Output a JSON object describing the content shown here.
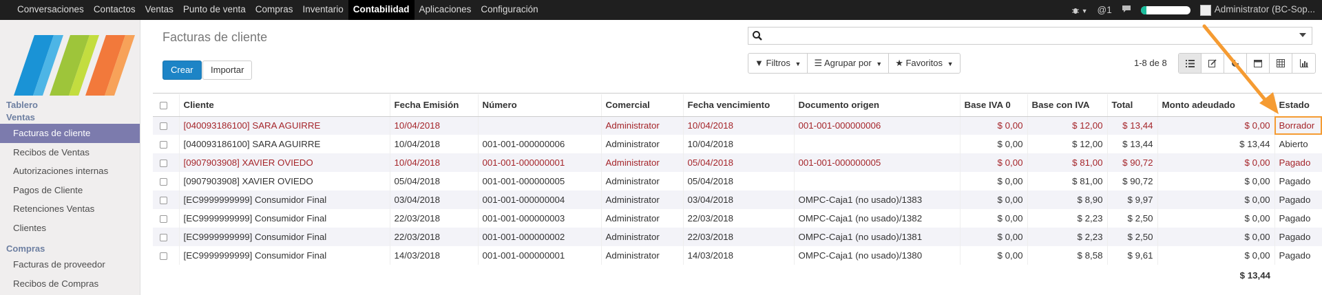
{
  "topbar": {
    "menus": [
      "Conversaciones",
      "Contactos",
      "Ventas",
      "Punto de venta",
      "Compras",
      "Inventario",
      "Contabilidad",
      "Aplicaciones",
      "Configuración"
    ],
    "active_menu": "Contabilidad",
    "mentions": "@1",
    "user": "Administrator (BC-Sop..."
  },
  "sidebar": {
    "sections": [
      {
        "title": "Tablero",
        "items": []
      },
      {
        "title": "Ventas",
        "items": [
          "Facturas de cliente",
          "Recibos de Ventas",
          "Autorizaciones internas",
          "Pagos de Cliente",
          "Retenciones Ventas",
          "Clientes"
        ]
      },
      {
        "title": "Compras",
        "items": [
          "Facturas de proveedor",
          "Recibos de Compras"
        ]
      }
    ],
    "active_item": "Facturas de cliente"
  },
  "control_panel": {
    "title": "Facturas de cliente",
    "create_label": "Crear",
    "import_label": "Importar",
    "search_value": "",
    "filters_label": "Filtros",
    "group_by_label": "Agrupar por",
    "favorites_label": "Favoritos",
    "pager": "1-8 de 8"
  },
  "table": {
    "columns": [
      "Cliente",
      "Fecha Emisión",
      "Número",
      "Comercial",
      "Fecha vencimiento",
      "Documento origen",
      "Base IVA 0",
      "Base con IVA",
      "Total",
      "Monto adeudado",
      "Estado"
    ],
    "rows": [
      {
        "style": "red",
        "cells": [
          "[040093186100] SARA AGUIRRE",
          "10/04/2018",
          "",
          "Administrator",
          "10/04/2018",
          "001-001-000000006",
          "$ 0,00",
          "$ 12,00",
          "$ 13,44",
          "$ 0,00",
          "Borrador"
        ]
      },
      {
        "style": "normal",
        "cells": [
          "[040093186100] SARA AGUIRRE",
          "10/04/2018",
          "001-001-000000006",
          "Administrator",
          "10/04/2018",
          "",
          "$ 0,00",
          "$ 12,00",
          "$ 13,44",
          "$ 13,44",
          "Abierto"
        ]
      },
      {
        "style": "red",
        "cells": [
          "[0907903908] XAVIER OVIEDO",
          "10/04/2018",
          "001-001-000000001",
          "Administrator",
          "05/04/2018",
          "001-001-000000005",
          "$ 0,00",
          "$ 81,00",
          "$ 90,72",
          "$ 0,00",
          "Pagado"
        ]
      },
      {
        "style": "normal",
        "cells": [
          "[0907903908] XAVIER OVIEDO",
          "05/04/2018",
          "001-001-000000005",
          "Administrator",
          "05/04/2018",
          "",
          "$ 0,00",
          "$ 81,00",
          "$ 90,72",
          "$ 0,00",
          "Pagado"
        ]
      },
      {
        "style": "normal",
        "cells": [
          "[EC9999999999] Consumidor Final",
          "03/04/2018",
          "001-001-000000004",
          "Administrator",
          "03/04/2018",
          "OMPC-Caja1 (no usado)/1383",
          "$ 0,00",
          "$ 8,90",
          "$ 9,97",
          "$ 0,00",
          "Pagado"
        ]
      },
      {
        "style": "normal",
        "cells": [
          "[EC9999999999] Consumidor Final",
          "22/03/2018",
          "001-001-000000003",
          "Administrator",
          "22/03/2018",
          "OMPC-Caja1 (no usado)/1382",
          "$ 0,00",
          "$ 2,23",
          "$ 2,50",
          "$ 0,00",
          "Pagado"
        ]
      },
      {
        "style": "normal",
        "cells": [
          "[EC9999999999] Consumidor Final",
          "22/03/2018",
          "001-001-000000002",
          "Administrator",
          "22/03/2018",
          "OMPC-Caja1 (no usado)/1381",
          "$ 0,00",
          "$ 2,23",
          "$ 2,50",
          "$ 0,00",
          "Pagado"
        ]
      },
      {
        "style": "normal",
        "cells": [
          "[EC9999999999] Consumidor Final",
          "14/03/2018",
          "001-001-000000001",
          "Administrator",
          "14/03/2018",
          "OMPC-Caja1 (no usado)/1380",
          "$ 0,00",
          "$ 8,58",
          "$ 9,61",
          "$ 0,00",
          "Pagado"
        ]
      }
    ],
    "total_amount_due": "$ 13,44"
  },
  "colors": {
    "accent": "#1d84c6",
    "sidebar_active": "#7c7bad",
    "highlight": "#f59b32",
    "red_row": "#a5252a"
  }
}
